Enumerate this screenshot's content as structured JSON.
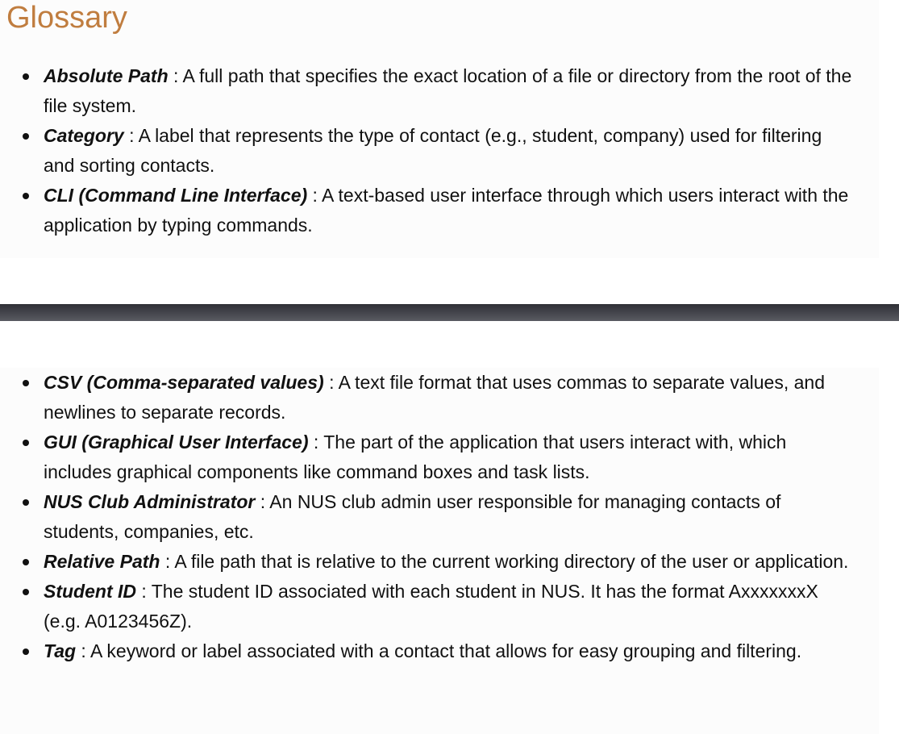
{
  "page": {
    "title": "Glossary"
  },
  "glossary_part1": [
    {
      "term": "Absolute Path",
      "definition": " : A full path that specifies the exact location of a file or directory from the root of the file system."
    },
    {
      "term": "Category",
      "definition": " : A label that represents the type of contact (e.g., student, company) used for filtering and sorting contacts."
    },
    {
      "term": "CLI (Command Line Interface)",
      "definition": " : A text-based user interface through which users interact with the application by typing commands."
    }
  ],
  "glossary_part2": [
    {
      "term": "CSV (Comma-separated values)",
      "definition": " : A text file format that uses commas to separate values, and newlines to separate records."
    },
    {
      "term": "GUI (Graphical User Interface)",
      "definition": " : The part of the application that users interact with, which includes graphical components like command boxes and task lists."
    },
    {
      "term": "NUS Club Administrator",
      "definition": " : An NUS club admin user responsible for managing contacts of students, companies, etc."
    },
    {
      "term": "Relative Path",
      "definition": " : A file path that is relative to the current working directory of the user or application."
    },
    {
      "term": "Student ID",
      "definition": " : The student ID associated with each student in NUS. It has the format AxxxxxxxX (e.g. A0123456Z)."
    },
    {
      "term": "Tag",
      "definition": " : A keyword or label associated with a contact that allows for easy grouping and filtering."
    }
  ]
}
